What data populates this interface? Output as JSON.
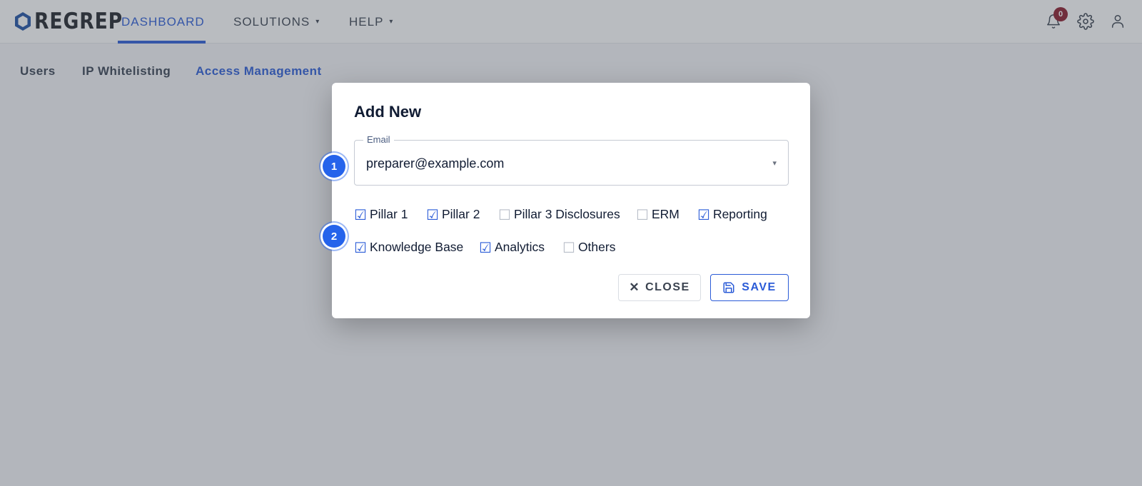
{
  "app": {
    "logo_text": "REGREP",
    "colors": {
      "accent": "#2a5bd7",
      "badge": "#8b1a2b",
      "brand_hex": "#1e4fa3"
    }
  },
  "nav": {
    "items": [
      {
        "label": "DASHBOARD",
        "active": true
      },
      {
        "label": "SOLUTIONS",
        "has_dropdown": true,
        "caret": "▾"
      },
      {
        "label": "HELP",
        "has_dropdown": true,
        "caret": "▾"
      }
    ],
    "notifications_count": "0",
    "icons": [
      "bell-icon",
      "gear-icon",
      "user-icon"
    ]
  },
  "subtabs": [
    {
      "label": "Users"
    },
    {
      "label": "IP Whitelisting"
    },
    {
      "label": "Access Management",
      "active": true
    }
  ],
  "modal": {
    "title": "Add New",
    "email": {
      "label": "Email",
      "value": "preparer@example.com",
      "caret": "▾"
    },
    "checkboxes": [
      {
        "label": "Pillar 1",
        "checked": true
      },
      {
        "label": "Pillar 2",
        "checked": true
      },
      {
        "label": "Pillar 3 Disclosures",
        "checked": false
      },
      {
        "label": "ERM",
        "checked": false
      },
      {
        "label": "Reporting",
        "checked": true
      },
      {
        "label": "Knowledge Base",
        "checked": true
      },
      {
        "label": "Analytics",
        "checked": true
      },
      {
        "label": "Others",
        "checked": false
      }
    ],
    "glyphs": {
      "checked": "☑",
      "unchecked": "☐",
      "close_x": "✕"
    },
    "close_label": "CLOSE",
    "save_label": "SAVE"
  },
  "steps": [
    "1",
    "2"
  ]
}
